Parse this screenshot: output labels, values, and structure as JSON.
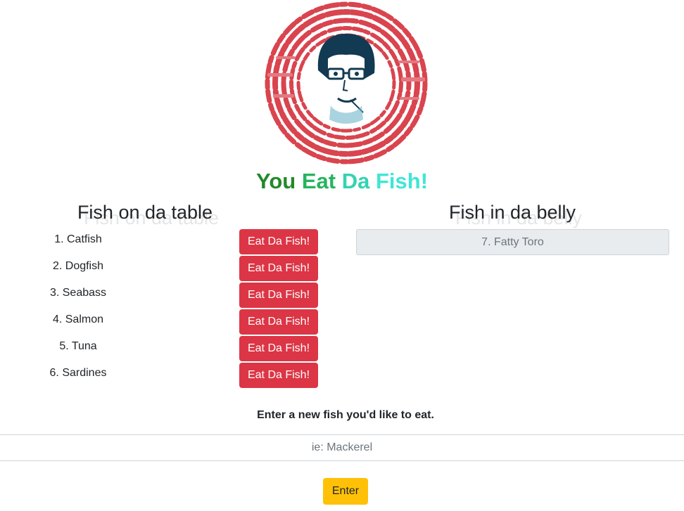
{
  "header": {
    "title_words": [
      "You",
      "Eat",
      "Da",
      "Fish!"
    ]
  },
  "logo": {
    "icon": "fish-quote-portrait-logo",
    "colors": {
      "text": "#d9444e",
      "face_outline": "#123a52",
      "face_bg": "#ffffff"
    }
  },
  "table_section": {
    "heading": "Fish on da table",
    "items": [
      {
        "label": "1. Catfish",
        "button": "Eat Da Fish!"
      },
      {
        "label": "2. Dogfish",
        "button": "Eat Da Fish!"
      },
      {
        "label": "3. Seabass",
        "button": "Eat Da Fish!"
      },
      {
        "label": "4. Salmon",
        "button": "Eat Da Fish!"
      },
      {
        "label": "5. Tuna",
        "button": "Eat Da Fish!"
      },
      {
        "label": "6. Sardines",
        "button": "Eat Da Fish!"
      }
    ]
  },
  "belly_section": {
    "heading": "Fish in da belly",
    "items": [
      {
        "label": "7. Fatty Toro"
      }
    ]
  },
  "form": {
    "label": "Enter a new fish you'd like to eat.",
    "placeholder": "ie: Mackerel",
    "value": "",
    "submit_label": "Enter"
  },
  "colors": {
    "eat_button": "#dc3545",
    "enter_button": "#ffc107",
    "title_gradient": [
      "#238a2a",
      "#27b360",
      "#33d3b0",
      "#3fe6d6"
    ],
    "belly_item_bg": "#e9ecef"
  }
}
